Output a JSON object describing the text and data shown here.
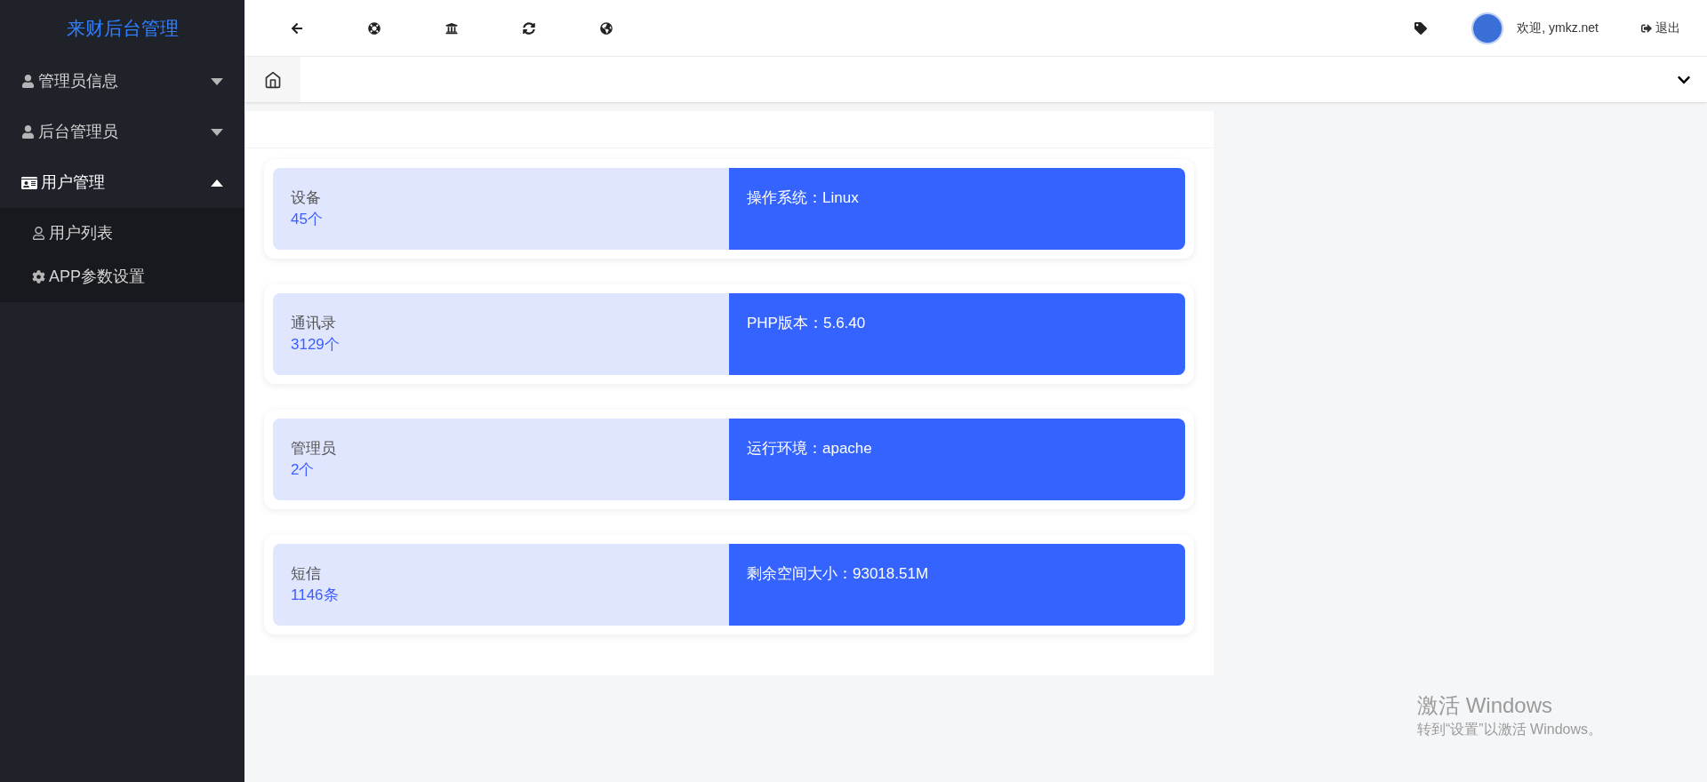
{
  "sidebar": {
    "title": "来财后台管理",
    "items": [
      {
        "label": "管理员信息",
        "expanded": false
      },
      {
        "label": "后台管理员",
        "expanded": false
      },
      {
        "label": "用户管理",
        "expanded": true,
        "children": [
          {
            "label": "用户列表"
          },
          {
            "label": "APP参数设置"
          }
        ]
      }
    ]
  },
  "header": {
    "welcome": "欢迎, ymkz.net",
    "logout": "退出"
  },
  "stats": [
    {
      "label": "设备",
      "count": "45个",
      "info": "操作系统：Linux"
    },
    {
      "label": "通讯录",
      "count": "3129个",
      "info": "PHP版本：5.6.40"
    },
    {
      "label": "管理员",
      "count": "2个",
      "info": "运行环境：apache"
    },
    {
      "label": "短信",
      "count": "1146条",
      "info": "剩余空间大小：93018.51M"
    }
  ],
  "os_overlay": {
    "title": "激活 Windows",
    "hint": "转到“设置”以激活 Windows。"
  }
}
